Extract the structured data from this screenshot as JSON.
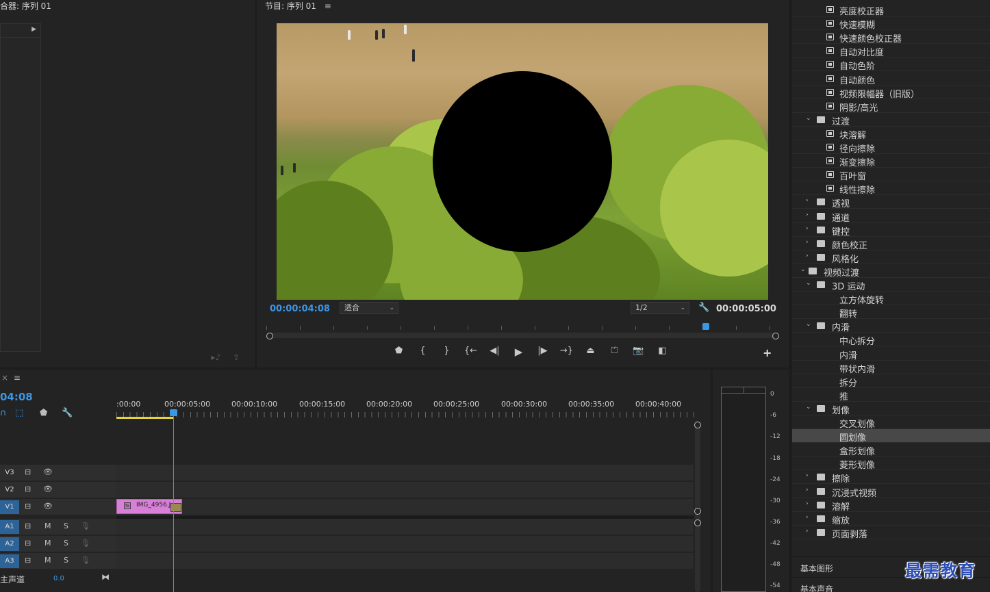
{
  "source_panel": {
    "title": "合器: 序列 01",
    "expand_arrow": "▶"
  },
  "program_monitor": {
    "title": "节目: 序列 01",
    "menu_icon": "≡",
    "current_time": "00:00:04:08",
    "fit_select": "适合",
    "resolution_select": "1/2",
    "duration": "00:00:05:00",
    "transport_buttons": [
      "marker-icon",
      "mark-in-icon",
      "mark-out-icon",
      "go-to-in-icon",
      "step-back-icon",
      "play-icon",
      "step-forward-icon",
      "go-to-out-icon",
      "lift-icon",
      "extract-icon",
      "export-frame-icon",
      "compare-icon"
    ],
    "add_button": "+"
  },
  "timeline": {
    "current_time": "04:08",
    "menu_icon": "≡",
    "ruler_labels": [
      ":00:00",
      "00:00:05:00",
      "00:00:10:00",
      "00:00:15:00",
      "00:00:20:00",
      "00:00:25:00",
      "00:00:30:00",
      "00:00:35:00",
      "00:00:40:00"
    ],
    "video_tracks": [
      {
        "name": "V3",
        "active": false
      },
      {
        "name": "V2",
        "active": false
      },
      {
        "name": "V1",
        "active": true
      }
    ],
    "audio_tracks": [
      {
        "name": "A1",
        "m": "M",
        "s": "S"
      },
      {
        "name": "A2",
        "m": "M",
        "s": "S"
      },
      {
        "name": "A3",
        "m": "M",
        "s": "S"
      }
    ],
    "clip": {
      "name": "IMG_4956.J",
      "fx_badge": "fx"
    },
    "master": {
      "label": "主声道",
      "value": "0.0",
      "end_icon": "⧓"
    }
  },
  "audio_meter": {
    "scale": [
      "0",
      "-6",
      "-12",
      "-18",
      "-24",
      "-30",
      "-36",
      "-42",
      "-48",
      "-54"
    ]
  },
  "effects": {
    "items": [
      {
        "label": "亮度校正器",
        "level": 2,
        "type": "effect"
      },
      {
        "label": "快速模糊",
        "level": 2,
        "type": "effect"
      },
      {
        "label": "快速颜色校正器",
        "level": 2,
        "type": "effect"
      },
      {
        "label": "自动对比度",
        "level": 2,
        "type": "effect"
      },
      {
        "label": "自动色阶",
        "level": 2,
        "type": "effect"
      },
      {
        "label": "自动颜色",
        "level": 2,
        "type": "effect"
      },
      {
        "label": "视频限幅器（旧版）",
        "level": 2,
        "type": "effect"
      },
      {
        "label": "阴影/高光",
        "level": 2,
        "type": "effect"
      },
      {
        "label": "过渡",
        "level": 1,
        "type": "folder",
        "expanded": true
      },
      {
        "label": "块溶解",
        "level": 2,
        "type": "effect"
      },
      {
        "label": "径向擦除",
        "level": 2,
        "type": "effect"
      },
      {
        "label": "渐变擦除",
        "level": 2,
        "type": "effect"
      },
      {
        "label": "百叶窗",
        "level": 2,
        "type": "effect"
      },
      {
        "label": "线性擦除",
        "level": 2,
        "type": "effect"
      },
      {
        "label": "透视",
        "level": 1,
        "type": "folder",
        "expanded": false
      },
      {
        "label": "通道",
        "level": 1,
        "type": "folder",
        "expanded": false
      },
      {
        "label": "键控",
        "level": 1,
        "type": "folder",
        "expanded": false
      },
      {
        "label": "颜色校正",
        "level": 1,
        "type": "folder",
        "expanded": false
      },
      {
        "label": "风格化",
        "level": 1,
        "type": "folder",
        "expanded": false
      },
      {
        "label": "视频过渡",
        "level": 0,
        "type": "folder",
        "expanded": true
      },
      {
        "label": "3D 运动",
        "level": 1,
        "type": "folder",
        "expanded": true
      },
      {
        "label": "立方体旋转",
        "level": 2,
        "type": "transition"
      },
      {
        "label": "翻转",
        "level": 2,
        "type": "transition"
      },
      {
        "label": "内滑",
        "level": 1,
        "type": "folder",
        "expanded": true
      },
      {
        "label": "中心拆分",
        "level": 2,
        "type": "transition"
      },
      {
        "label": "内滑",
        "level": 2,
        "type": "transition"
      },
      {
        "label": "带状内滑",
        "level": 2,
        "type": "transition"
      },
      {
        "label": "拆分",
        "level": 2,
        "type": "transition"
      },
      {
        "label": "推",
        "level": 2,
        "type": "transition"
      },
      {
        "label": "划像",
        "level": 1,
        "type": "folder",
        "expanded": true
      },
      {
        "label": "交叉划像",
        "level": 2,
        "type": "transition"
      },
      {
        "label": "圆划像",
        "level": 2,
        "type": "transition",
        "selected": true
      },
      {
        "label": "盒形划像",
        "level": 2,
        "type": "transition"
      },
      {
        "label": "菱形划像",
        "level": 2,
        "type": "transition"
      },
      {
        "label": "擦除",
        "level": 1,
        "type": "folder",
        "expanded": false
      },
      {
        "label": "沉浸式视频",
        "level": 1,
        "type": "folder",
        "expanded": false
      },
      {
        "label": "溶解",
        "level": 1,
        "type": "folder",
        "expanded": false
      },
      {
        "label": "缩放",
        "level": 1,
        "type": "folder",
        "expanded": false
      },
      {
        "label": "页面剥落",
        "level": 1,
        "type": "folder",
        "expanded": false
      }
    ],
    "bottom_panels": [
      "基本图形",
      "基本声音"
    ]
  },
  "watermark": "最需教育",
  "colors": {
    "accent": "#3d96e4",
    "clip": "#d87fd8",
    "work_area": "#e2d43a",
    "track_active": "#2e6397"
  }
}
